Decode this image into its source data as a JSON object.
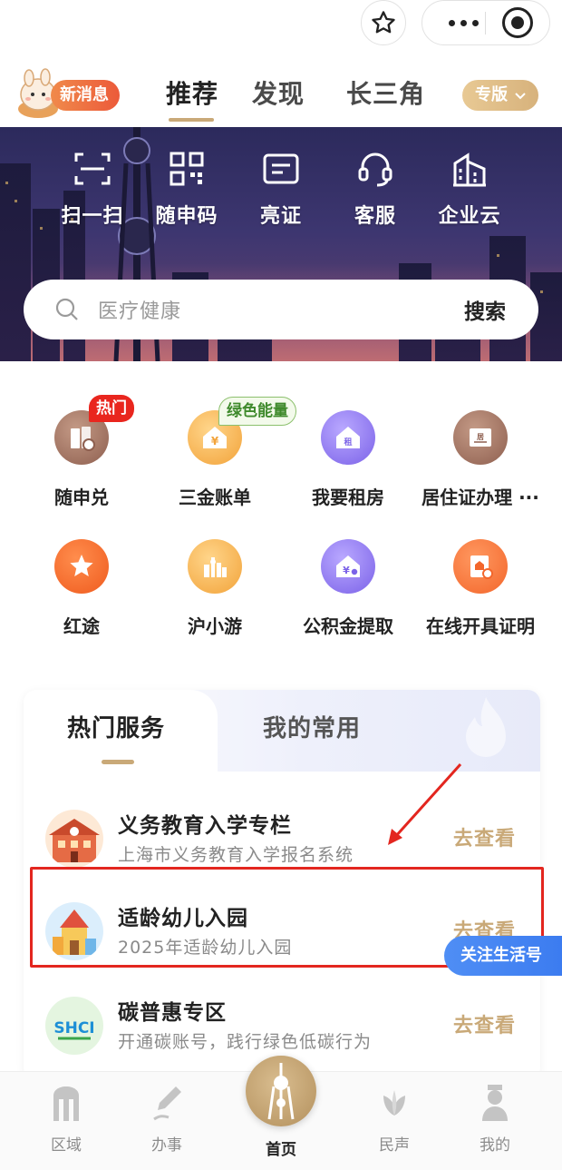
{
  "nav": {
    "message_badge": "新消息",
    "tabs": [
      {
        "label": "推荐",
        "active": true
      },
      {
        "label": "发现",
        "active": false
      },
      {
        "label": "长三角",
        "active": false
      }
    ],
    "edition_label": "专版"
  },
  "quick_actions": [
    {
      "label": "扫一扫",
      "icon": "scan-icon"
    },
    {
      "label": "随申码",
      "icon": "qr-code-icon"
    },
    {
      "label": "亮证",
      "icon": "id-card-icon"
    },
    {
      "label": "客服",
      "icon": "customer-service-icon"
    },
    {
      "label": "企业云",
      "icon": "enterprise-building-icon"
    }
  ],
  "search": {
    "placeholder": "医疗健康",
    "button_label": "搜索"
  },
  "services": [
    {
      "label": "随申兑",
      "badge": "热门",
      "icon": "redeem-icon"
    },
    {
      "label": "三金账单",
      "badge": "绿色能量",
      "icon": "house-yuan-icon"
    },
    {
      "label": "我要租房",
      "icon": "rent-house-icon"
    },
    {
      "label": "居住证办理 ···",
      "icon": "residence-permit-icon"
    },
    {
      "label": "红途",
      "icon": "red-star-icon"
    },
    {
      "label": "沪小游",
      "icon": "city-tour-icon"
    },
    {
      "label": "公积金提取",
      "icon": "housing-fund-icon"
    },
    {
      "label": "在线开具证明",
      "icon": "certificate-icon"
    }
  ],
  "hot_card": {
    "tabs": [
      {
        "label": "热门服务",
        "active": true
      },
      {
        "label": "我的常用",
        "active": false
      }
    ],
    "items": [
      {
        "title": "义务教育入学专栏",
        "subtitle": "上海市义务教育入学报名系统",
        "action": "去查看"
      },
      {
        "title": "适龄幼儿入园",
        "subtitle": "2025年适龄幼儿入园",
        "action": "去查看"
      },
      {
        "title": "碳普惠专区",
        "subtitle": "开通碳账号，践行绿色低碳行为",
        "action": "去查看"
      }
    ],
    "carbon_logo_text": "SHCI",
    "follow_label": "关注生活号"
  },
  "tabbar": [
    {
      "label": "区域",
      "icon": "region-icon"
    },
    {
      "label": "办事",
      "icon": "pen-icon"
    },
    {
      "label": "首页",
      "icon": "pearl-tower-icon",
      "active": true
    },
    {
      "label": "民声",
      "icon": "magnolia-icon"
    },
    {
      "label": "我的",
      "icon": "person-icon"
    }
  ],
  "colors": {
    "accent_gold": "#c9a978",
    "hot_red": "#e9261e",
    "annotation_red": "#e3261f",
    "follow_blue": "#3c7cf0"
  }
}
